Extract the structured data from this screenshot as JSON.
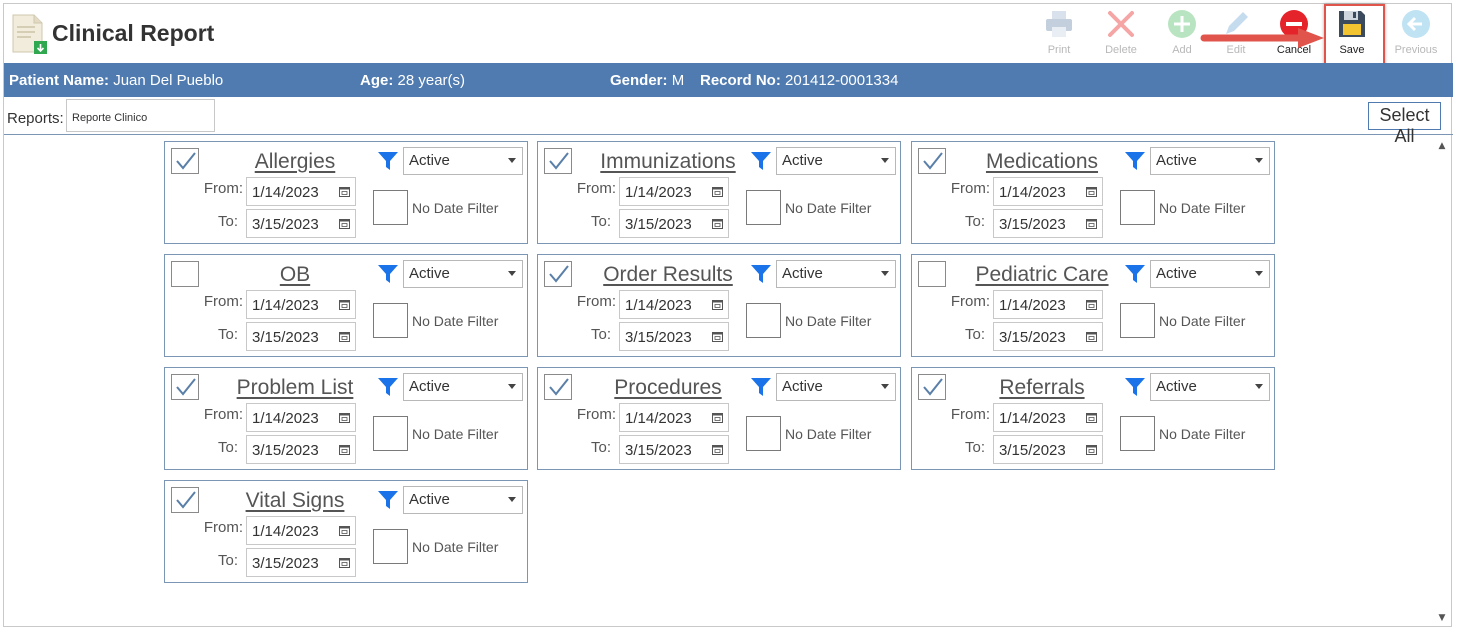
{
  "header": {
    "title": "Clinical Report"
  },
  "toolbar": {
    "print": "Print",
    "delete": "Delete",
    "add": "Add",
    "edit": "Edit",
    "cancel": "Cancel",
    "save": "Save",
    "previous": "Previous"
  },
  "patient": {
    "name_label": "Patient Name:",
    "name": "Juan Del Pueblo",
    "age_label": "Age:",
    "age": "28 year(s)",
    "gender_label": "Gender:",
    "gender": "M",
    "record_label": "Record No:",
    "record": "201412-0001334"
  },
  "reports": {
    "label": "Reports:",
    "value": "Reporte Clinico",
    "select_all": "Select All"
  },
  "common": {
    "from_label": "From:",
    "to_label": "To:",
    "no_date_filter": "No Date Filter"
  },
  "cards": [
    {
      "title": "Allergies",
      "checked": true,
      "status": "Active",
      "from": "1/14/2023",
      "to": "3/15/2023"
    },
    {
      "title": "Immunizations",
      "checked": true,
      "status": "Active",
      "from": "1/14/2023",
      "to": "3/15/2023"
    },
    {
      "title": "Medications",
      "checked": true,
      "status": "Active",
      "from": "1/14/2023",
      "to": "3/15/2023"
    },
    {
      "title": "OB",
      "checked": false,
      "status": "Active",
      "from": "1/14/2023",
      "to": "3/15/2023"
    },
    {
      "title": "Order Results",
      "checked": true,
      "status": "Active",
      "from": "1/14/2023",
      "to": "3/15/2023"
    },
    {
      "title": "Pediatric Care",
      "checked": false,
      "status": "Active",
      "from": "1/14/2023",
      "to": "3/15/2023"
    },
    {
      "title": "Problem List",
      "checked": true,
      "status": "Active",
      "from": "1/14/2023",
      "to": "3/15/2023"
    },
    {
      "title": "Procedures",
      "checked": true,
      "status": "Active",
      "from": "1/14/2023",
      "to": "3/15/2023"
    },
    {
      "title": "Referrals",
      "checked": true,
      "status": "Active",
      "from": "1/14/2023",
      "to": "3/15/2023"
    },
    {
      "title": "Vital Signs",
      "checked": true,
      "status": "Active",
      "from": "1/14/2023",
      "to": "3/15/2023"
    }
  ],
  "colors": {
    "patient_bar": "#4f7bb0",
    "border": "#7b96b4",
    "filter_icon": "#1a73e8",
    "check": "#5a7fa8",
    "highlight": "#e0544b"
  }
}
